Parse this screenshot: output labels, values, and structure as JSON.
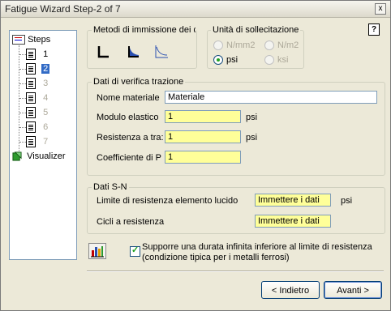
{
  "window": {
    "title": "Fatigue Wizard Step-2 of 7",
    "close_glyph": "x",
    "help_glyph": "?"
  },
  "tree": {
    "root_label": "Steps",
    "items": [
      {
        "label": "1"
      },
      {
        "label": "2",
        "selected": true
      },
      {
        "label": "3"
      },
      {
        "label": "4"
      },
      {
        "label": "5"
      },
      {
        "label": "6"
      },
      {
        "label": "7"
      }
    ],
    "visualizer_label": "Visualizer"
  },
  "methods": {
    "group_label": "Metodi di immissione dei da",
    "buttons": [
      "method-l-shape-icon",
      "method-filled-curve-icon",
      "method-curve-icon"
    ]
  },
  "units": {
    "group_label": "Unità di sollecitazione",
    "options": [
      {
        "label": "N/mm2",
        "enabled": false,
        "checked": false
      },
      {
        "label": "N/m2",
        "enabled": false,
        "checked": false
      },
      {
        "label": "psi",
        "enabled": true,
        "checked": true
      },
      {
        "label": "ksi",
        "enabled": false,
        "checked": false
      }
    ]
  },
  "traction": {
    "group_label": "Dati di verifica trazione",
    "material_label": "Nome materiale",
    "material_value": "Materiale",
    "modulus_label": "Modulo elastico",
    "modulus_value": "1",
    "modulus_unit": "psi",
    "strength_label": "Resistenza a tra:",
    "strength_value": "1",
    "strength_unit": "psi",
    "poisson_label": "Coefficiente di P",
    "poisson_value": "1"
  },
  "sn": {
    "group_label": "Dati S-N",
    "endurance_label": "Limite di resistenza elemento lucido",
    "endurance_value": "Immettere i dati",
    "endurance_unit": "psi",
    "cycles_label": "Cicli a resistenza",
    "cycles_value": "Immettere i dati"
  },
  "infinite_life": {
    "checked": true,
    "label_line1": "Supporre una durata infinita inferiore al limite di resistenza",
    "label_line2": "(condizione tipica per i metalli ferrosi)"
  },
  "buttons": {
    "back": "< Indietro",
    "next": "Avanti >"
  }
}
